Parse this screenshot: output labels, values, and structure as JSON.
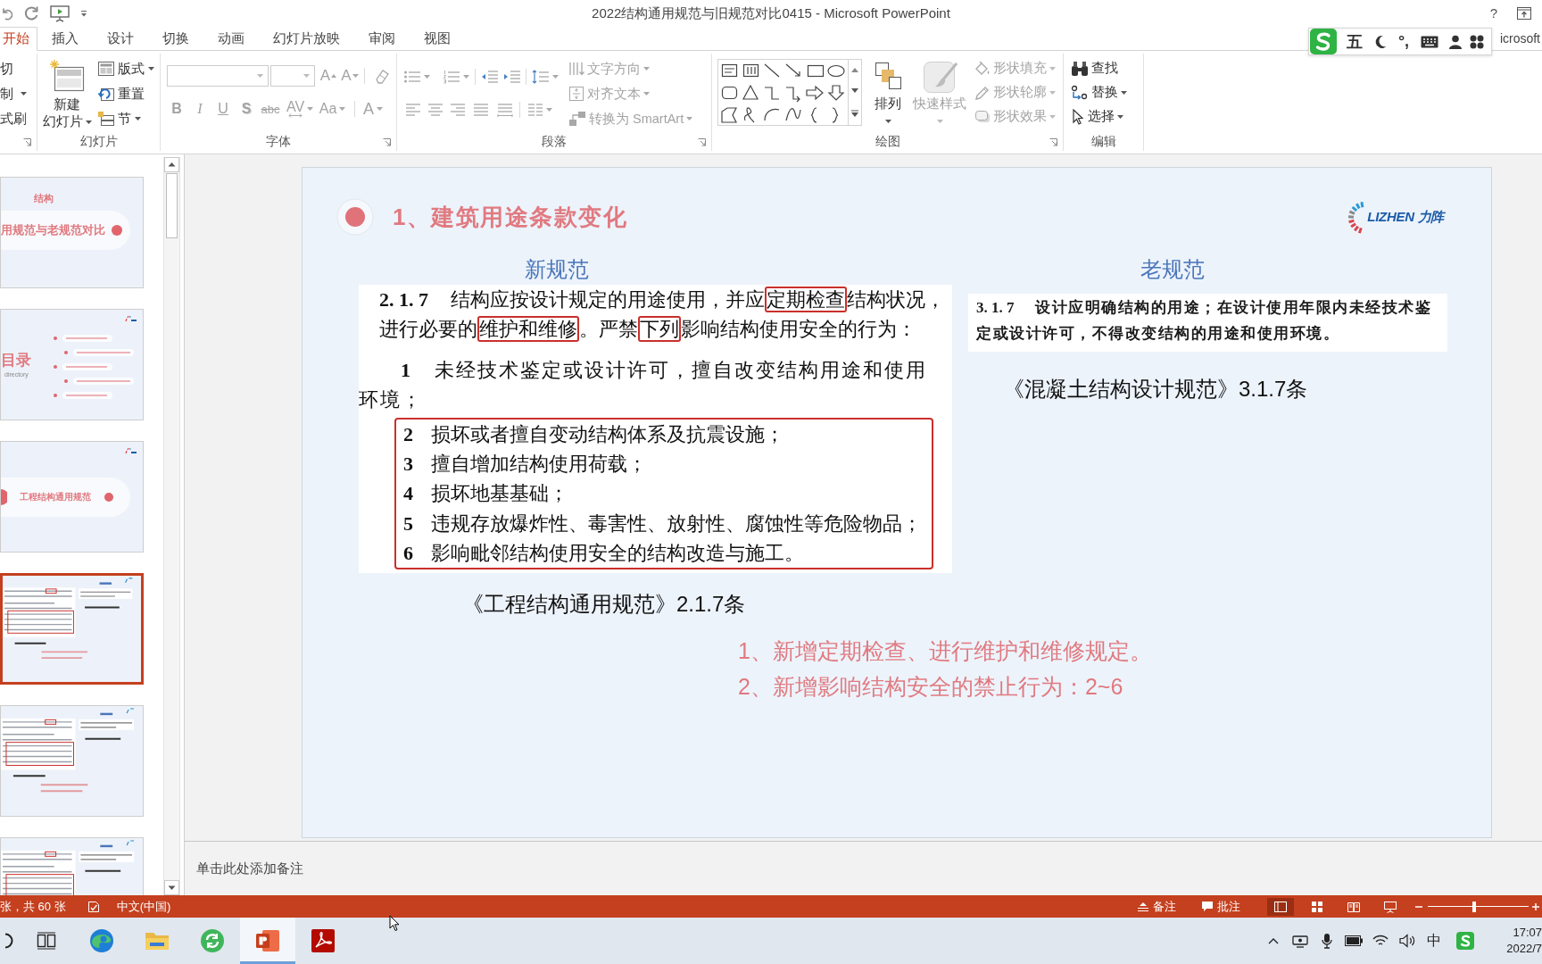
{
  "window": {
    "title": "2022结构通用规范与旧规范对比0415 - Microsoft PowerPoint",
    "help": "?"
  },
  "tabs": [
    {
      "label": "开始",
      "selected": true
    },
    {
      "label": "插入",
      "selected": false
    },
    {
      "label": "设计",
      "selected": false
    },
    {
      "label": "切换",
      "selected": false
    },
    {
      "label": "动画",
      "selected": false
    },
    {
      "label": "幻灯片放映",
      "selected": false
    },
    {
      "label": "审阅",
      "selected": false
    },
    {
      "label": "视图",
      "selected": false
    }
  ],
  "account": "icrosoft",
  "ime_toolbar": {
    "mode": "五",
    "punctuation": "°,"
  },
  "ribbon": {
    "clipboard": [
      {
        "label": "切",
        "dropdown": false
      },
      {
        "label": "制",
        "dropdown": true
      },
      {
        "label": "式刷",
        "dropdown": false
      }
    ],
    "slides": {
      "label": "幻灯片",
      "new_slide": [
        "新建",
        "幻灯片"
      ],
      "commands": [
        {
          "label": "版式",
          "kind": "layout",
          "dropdown": true
        },
        {
          "label": "重置",
          "kind": "reset",
          "dropdown": false
        },
        {
          "label": "节",
          "kind": "section",
          "dropdown": true
        }
      ]
    },
    "font": {
      "label": "字体",
      "disabled": true,
      "size_buttons": [
        {
          "label": "A",
          "kind": "grow"
        },
        {
          "label": "A",
          "kind": "shrink"
        }
      ],
      "format_buttons": [
        {
          "label": "B",
          "kind": "bold",
          "dropdown": false
        },
        {
          "label": "I",
          "kind": "italic",
          "dropdown": false
        },
        {
          "label": "U",
          "kind": "underline",
          "dropdown": false
        },
        {
          "label": "S",
          "kind": "shadow",
          "dropdown": false
        },
        {
          "label": "abc",
          "kind": "strike",
          "dropdown": false
        },
        {
          "label": "AV",
          "kind": "spacing",
          "dropdown": true
        },
        {
          "label": "Aa",
          "kind": "case",
          "dropdown": true
        },
        {
          "label": "A",
          "kind": "color",
          "dropdown": true
        }
      ]
    },
    "paragraph": {
      "label": "段落",
      "disabled": true,
      "commands": [
        {
          "label": "文字方向",
          "kind": "direction"
        },
        {
          "label": "对齐文本",
          "kind": "align"
        },
        {
          "label": "转换为 SmartArt",
          "kind": "smartart"
        }
      ]
    },
    "drawing": {
      "label": "绘图",
      "arrange": "排列",
      "quick_styles": {
        "label": "快速样式",
        "disabled": true
      },
      "commands": [
        {
          "label": "形状填充",
          "kind": "fill",
          "disabled": true
        },
        {
          "label": "形状轮廓",
          "kind": "outline",
          "disabled": true
        },
        {
          "label": "形状效果",
          "kind": "effects",
          "disabled": true
        }
      ]
    },
    "editing": {
      "label": "编辑",
      "commands": [
        {
          "label": "查找",
          "kind": "find",
          "dropdown": false
        },
        {
          "label": "替换",
          "kind": "replace",
          "dropdown": true
        },
        {
          "label": "选择",
          "kind": "select",
          "dropdown": true
        }
      ]
    }
  },
  "thumbnails": [
    {
      "kind": "title",
      "texts": [
        "结构",
        "用规范与老规范对比"
      ],
      "selected": false
    },
    {
      "kind": "toc",
      "texts": [
        "目录",
        "directory"
      ],
      "selected": false
    },
    {
      "kind": "section",
      "texts": [
        "工程结构通用规范"
      ],
      "selected": false
    },
    {
      "kind": "content",
      "selected": true
    },
    {
      "kind": "content",
      "selected": false
    },
    {
      "kind": "content",
      "selected": false
    }
  ],
  "slide": {
    "title": "1、建筑用途条款变化",
    "logo": "LIZHEN 力阵",
    "new_spec": {
      "heading": "新规范",
      "clause": "2. 1. 7",
      "lines": [
        {
          "segments": [
            {
              "text": "结构应按设计规定的用途使用，并应",
              "boxed": false
            },
            {
              "text": "定期检查",
              "boxed": true
            },
            {
              "text": "结构状况，",
              "boxed": false
            }
          ]
        },
        {
          "segments": [
            {
              "text": "进行必要的",
              "boxed": false
            },
            {
              "text": "维护和维修",
              "boxed": true
            },
            {
              "text": "。严禁",
              "boxed": false
            },
            {
              "text": "下列",
              "boxed": true
            },
            {
              "text": "影响结构使用安全的行为：",
              "boxed": false
            }
          ]
        }
      ],
      "items": [
        {
          "number": "1",
          "text": "未经技术鉴定或设计许可，擅自改变结构用途和使用环境；",
          "boxed": false
        },
        {
          "number": "2",
          "text": "损坏或者擅自变动结构体系及抗震设施；",
          "boxed": true
        },
        {
          "number": "3",
          "text": "擅自增加结构使用荷载；",
          "boxed": true
        },
        {
          "number": "4",
          "text": "损坏地基基础；",
          "boxed": true
        },
        {
          "number": "5",
          "text": "违规存放爆炸性、毒害性、放射性、腐蚀性等危险物品；",
          "boxed": true
        },
        {
          "number": "6",
          "text": "影响毗邻结构使用安全的结构改造与施工。",
          "boxed": true
        }
      ],
      "source": "《工程结构通用规范》2.1.7条"
    },
    "old_spec": {
      "heading": "老规范",
      "clause": "3. 1. 7",
      "text": "设计应明确结构的用途；在设计使用年限内未经技术鉴定或设计许可，不得改变结构的用途和使用环境。",
      "source": "《混凝土结构设计规范》3.1.7条"
    },
    "summary": [
      "1、新增定期检查、进行维护和维修规定。",
      "2、新增影响结构安全的禁止行为：2~6"
    ]
  },
  "notes": {
    "placeholder": "单击此处添加备注"
  },
  "status_bar": {
    "slide_info": "张，共 60 张",
    "language": "中文(中国)",
    "notes": "备注",
    "comments": "批注",
    "views": [
      {
        "kind": "normal",
        "selected": true
      },
      {
        "kind": "sorter",
        "selected": false
      },
      {
        "kind": "reading",
        "selected": false
      },
      {
        "kind": "slideshow",
        "selected": false
      }
    ],
    "zoom": {
      "level": 0.46
    }
  },
  "taskbar": {
    "apps": [
      {
        "kind": "search",
        "active": false
      },
      {
        "kind": "taskview",
        "active": false
      },
      {
        "kind": "browser",
        "active": false
      },
      {
        "kind": "folder",
        "active": false
      },
      {
        "kind": "sync",
        "active": false
      },
      {
        "kind": "presentation",
        "active": true
      },
      {
        "kind": "pdf",
        "active": false
      }
    ],
    "ime_mode": "中",
    "time": "17:07",
    "date": "2022/7"
  }
}
